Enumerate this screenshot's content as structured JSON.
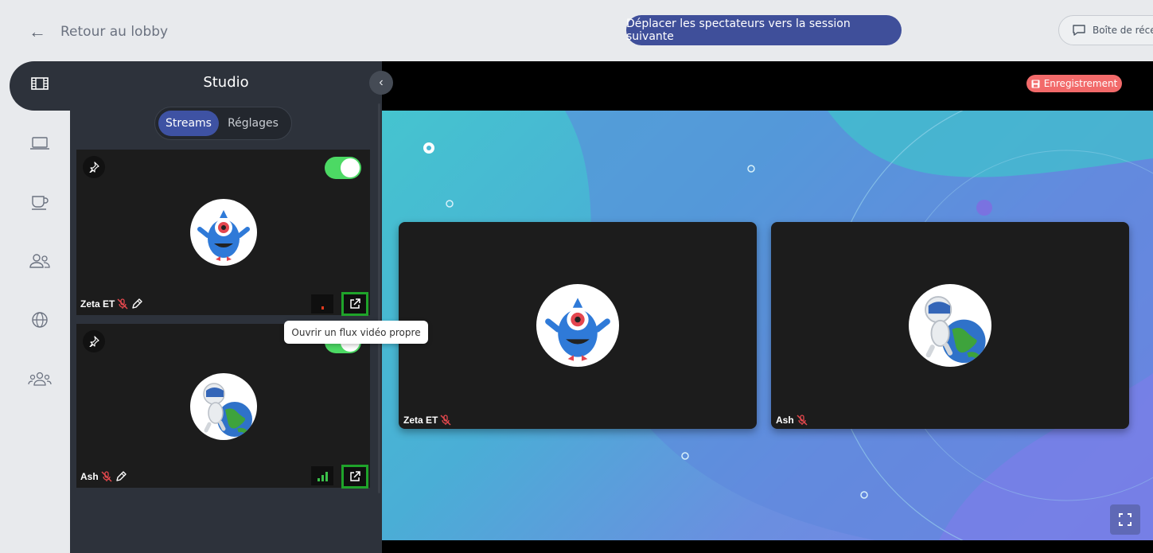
{
  "header": {
    "back_label": "Retour au lobby",
    "move_button": "Déplacer les spectateurs vers la session suivante",
    "inbox_label": "Boîte de réce"
  },
  "rail": {
    "items": [
      {
        "icon": "film-icon",
        "active": true
      },
      {
        "icon": "laptop-icon",
        "active": false
      },
      {
        "icon": "coffee-cup-icon",
        "active": false
      },
      {
        "icon": "users-icon",
        "active": false
      },
      {
        "icon": "globe-icon",
        "active": false
      },
      {
        "icon": "group-icon",
        "active": false
      }
    ]
  },
  "studio": {
    "title": "Studio",
    "tabs": [
      "Streams",
      "Réglages"
    ],
    "active_tab": "Streams",
    "streams": [
      {
        "name": "Zeta ET",
        "avatar": "blue-monster",
        "enabled": true,
        "muted": true,
        "signal": 1,
        "signal_color": "#e03a1e"
      },
      {
        "name": "Ash",
        "avatar": "astronaut-globe",
        "enabled": true,
        "muted": true,
        "signal": 3,
        "signal_color": "#3bc14a"
      }
    ],
    "tooltip": "Ouvrir un flux vidéo propre"
  },
  "stage": {
    "recording_label": "Enregistrement",
    "tiles": [
      {
        "name": "Zeta ET",
        "avatar": "blue-monster",
        "muted": true
      },
      {
        "name": "Ash",
        "avatar": "astronaut-globe",
        "muted": true
      }
    ]
  },
  "colors": {
    "accent": "#3f4f9a",
    "panel": "#2d323b",
    "toggle_on": "#4cd964",
    "recording": "#f26a6a",
    "highlight": "#1fa32a"
  }
}
